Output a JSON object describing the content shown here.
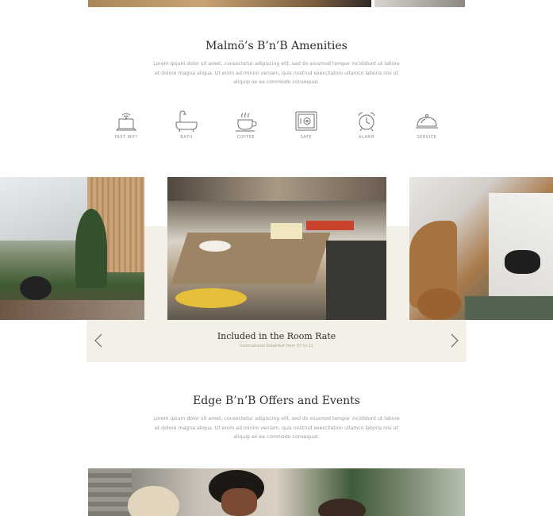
{
  "amenities_section": {
    "title": "Malmö’s B’n’B Amenities",
    "description": "Lorem ipsum dolor sit amet, consectetur adipiscing elit, sed do eiusmod tempor incididunt ut labore et dolore magna aliqua. Ut enim ad minim veniam, quis nostrud exercitation ullamco laboris nisi ut aliquip ex ea commodo consequat.",
    "items": [
      {
        "label": "FAST WIFI",
        "icon": "laptop-wifi-icon"
      },
      {
        "label": "BATH",
        "icon": "bathtub-icon"
      },
      {
        "label": "COFFEE",
        "icon": "coffee-cup-icon"
      },
      {
        "label": "SAFE",
        "icon": "safe-icon"
      },
      {
        "label": "ALARM",
        "icon": "alarm-clock-icon"
      },
      {
        "label": "SERVICE",
        "icon": "room-service-cloche-icon"
      }
    ]
  },
  "carousel": {
    "caption_title": "Included in the Room Rate",
    "caption_subtitle": "International breakfast from 07 to 11",
    "prev_icon": "chevron-left-icon",
    "next_icon": "chevron-right-icon",
    "accent_color": "#f3f0e8"
  },
  "events_section": {
    "title": "Edge B’n’B Offers and Events",
    "description": "Lorem ipsum dolor sit amet, consectetur adipiscing elit, sed do eiusmod tempor incididunt ut labore et dolore magna aliqua. Ut enim ad minim veniam, quis nostrud exercitation ullamco laboris nisi ut aliquip ex ea commodo consequat."
  }
}
